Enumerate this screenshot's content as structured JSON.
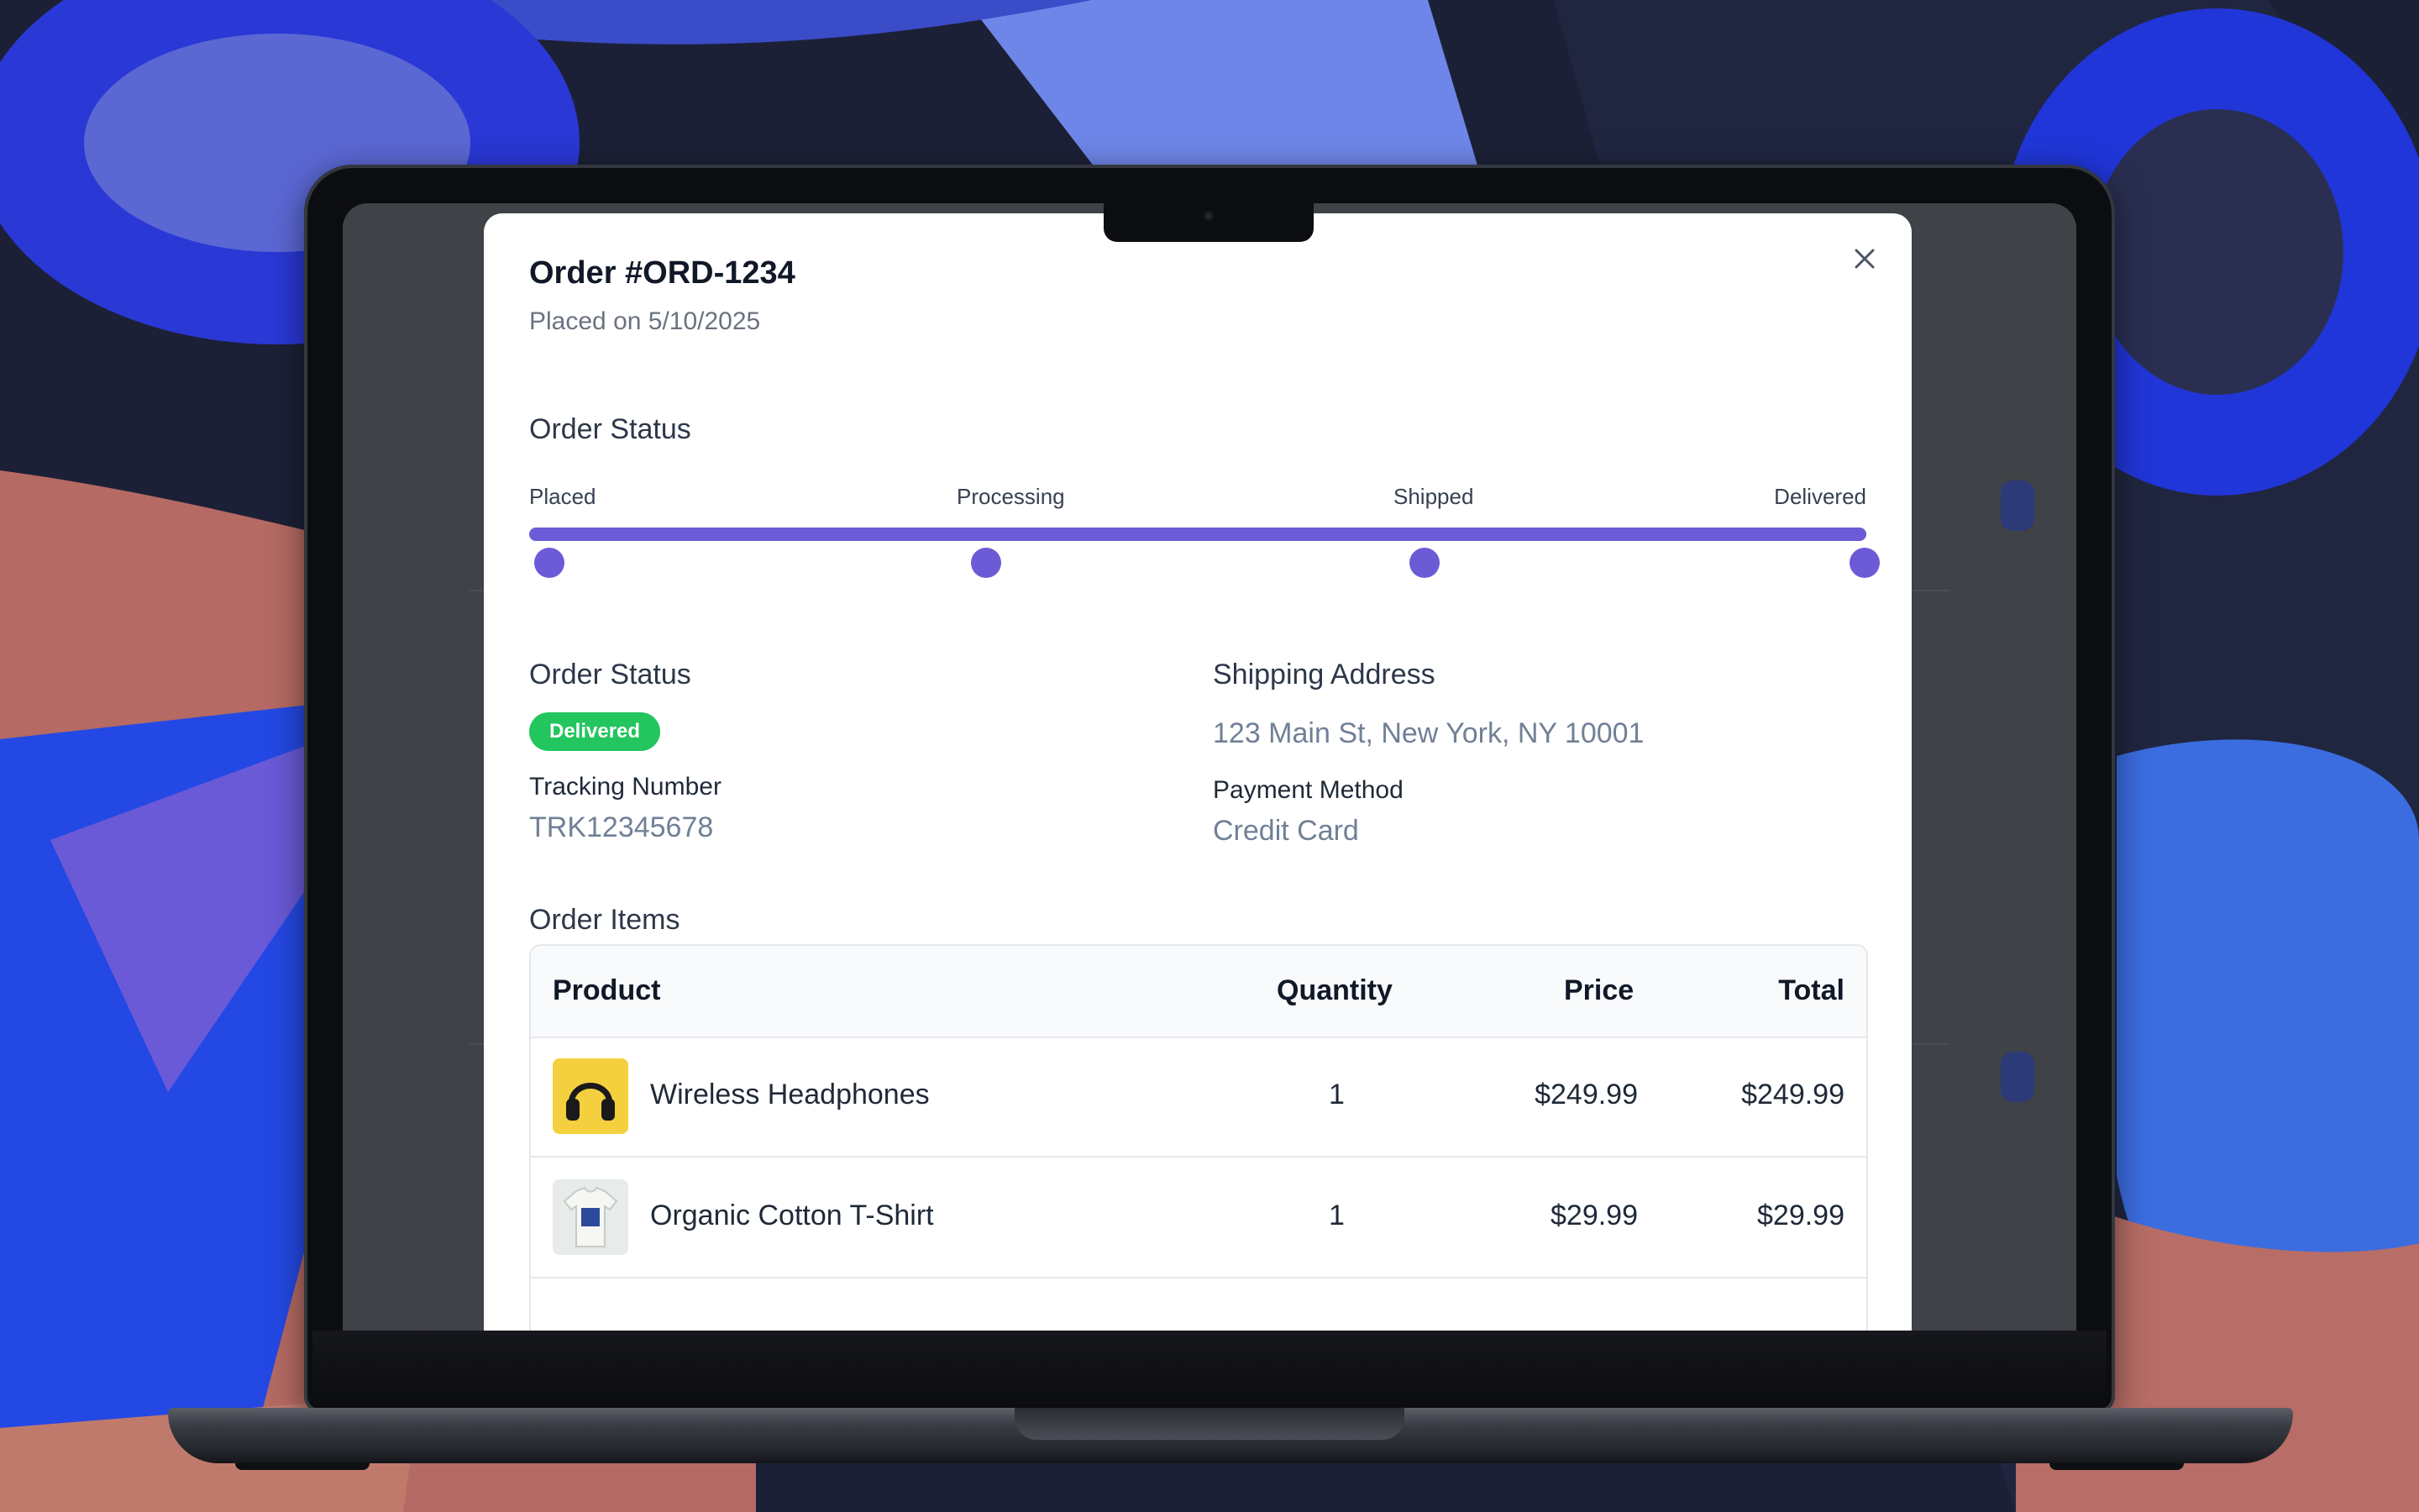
{
  "modal": {
    "title": "Order #ORD-1234",
    "subtitle": "Placed on 5/10/2025",
    "progress_heading": "Order Status",
    "steps": [
      "Placed",
      "Processing",
      "Shipped",
      "Delivered"
    ],
    "progress_fraction": 1.0,
    "status_heading": "Order Status",
    "status_badge": "Delivered",
    "tracking_label": "Tracking Number",
    "tracking_value": "TRK12345678",
    "shipping_heading": "Shipping Address",
    "shipping_value": "123 Main St, New York, NY 10001",
    "payment_label": "Payment Method",
    "payment_value": "Credit Card",
    "items_heading": "Order Items"
  },
  "table": {
    "headers": [
      "Product",
      "Quantity",
      "Price",
      "Total"
    ],
    "rows": [
      {
        "product": "Wireless Headphones",
        "quantity": "1",
        "price": "$249.99",
        "total": "$249.99",
        "icon": "headphones-thumbnail"
      },
      {
        "product": "Organic Cotton T-Shirt",
        "quantity": "1",
        "price": "$29.99",
        "total": "$29.99",
        "icon": "tshirt-thumbnail"
      }
    ]
  },
  "colors": {
    "accent": "#6b5bd6",
    "success": "#22c55e",
    "muted_text": "#718096"
  }
}
